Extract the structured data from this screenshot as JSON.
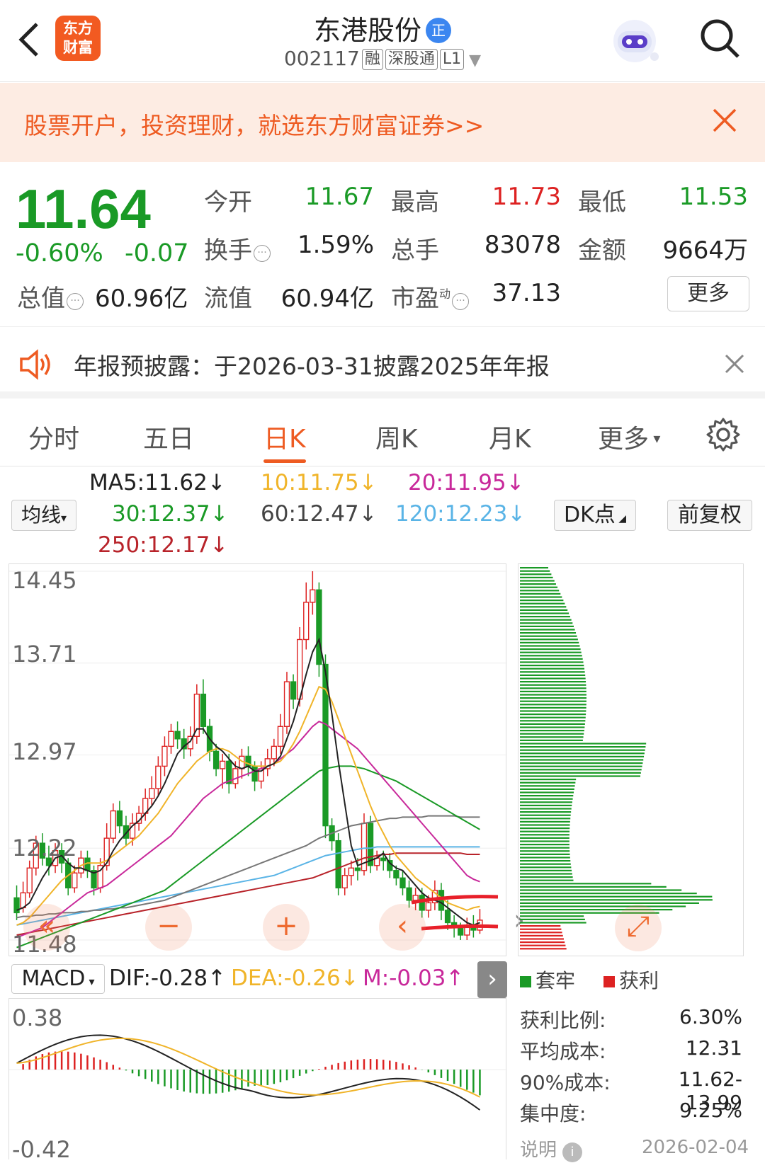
{
  "header": {
    "title": "东港股份",
    "title_badge": "正",
    "code": "002117",
    "tags": [
      "融",
      "深股通",
      "L1"
    ]
  },
  "banner": {
    "text": "股票开户，投资理财，就选东方财富证券>>"
  },
  "logo": {
    "line1": "东方",
    "line2": "财富"
  },
  "quote": {
    "price": "11.64",
    "change_pct": "-0.60%",
    "change": "-0.07",
    "open_label": "今开",
    "open": "11.67",
    "high_label": "最高",
    "high": "11.73",
    "low_label": "最低",
    "low": "11.53",
    "turnover_label": "换手",
    "turnover": "1.59%",
    "volume_label": "总手",
    "volume": "83078",
    "amount_label": "金额",
    "amount": "9664万",
    "mktcap_label": "总值",
    "mktcap": "60.96亿",
    "float_label": "流值",
    "float": "60.94亿",
    "pe_label": "市盈",
    "pe_sup": "动",
    "pe": "37.13",
    "more": "更多"
  },
  "notice": {
    "text": "年报预披露：于2026-03-31披露2025年年报"
  },
  "tabs": [
    "分时",
    "五日",
    "日K",
    "周K",
    "月K",
    "更多"
  ],
  "ma": {
    "toggle": "均线",
    "ma5": "MA5:11.62↓",
    "ma10": "10:11.75↓",
    "ma20": "20:11.95↓",
    "ma30": "30:12.37↓",
    "ma60": "60:12.47↓",
    "ma120": "120:12.23↓",
    "ma250": "250:12.17↓",
    "dk": "DK点",
    "adj": "前复权"
  },
  "colors": {
    "up": "#dd2222",
    "down": "#1a9a26",
    "accent": "#ee5b22",
    "ma5": "#222222",
    "ma10": "#f0b429",
    "ma20": "#c8289a",
    "ma30": "#1a9a26",
    "ma60": "#777777",
    "ma120": "#5ab4e6",
    "ma250": "#b8232a"
  },
  "chart_data": {
    "type": "candlestick",
    "y_ticks": [
      "14.45",
      "13.71",
      "12.97",
      "12.22",
      "11.48"
    ],
    "ylim": [
      11.48,
      14.45
    ],
    "candles": [
      [
        11.82,
        11.7,
        11.92,
        11.64
      ],
      [
        11.74,
        11.86,
        11.95,
        11.7
      ],
      [
        11.86,
        12.06,
        12.12,
        11.82
      ],
      [
        12.06,
        12.26,
        12.32,
        12.0
      ],
      [
        12.26,
        12.14,
        12.34,
        12.08
      ],
      [
        12.14,
        12.08,
        12.24,
        12.0
      ],
      [
        12.08,
        12.2,
        12.26,
        12.02
      ],
      [
        12.2,
        12.1,
        12.26,
        12.02
      ],
      [
        12.1,
        11.9,
        12.14,
        11.84
      ],
      [
        11.9,
        12.02,
        12.08,
        11.86
      ],
      [
        12.02,
        12.14,
        12.2,
        11.98
      ],
      [
        12.14,
        12.04,
        12.2,
        11.98
      ],
      [
        12.04,
        11.9,
        12.08,
        11.84
      ],
      [
        11.9,
        12.08,
        12.14,
        11.86
      ],
      [
        12.08,
        12.3,
        12.42,
        12.04
      ],
      [
        12.3,
        12.52,
        12.58,
        12.26
      ],
      [
        12.52,
        12.4,
        12.6,
        12.34
      ],
      [
        12.4,
        12.3,
        12.48,
        12.24
      ],
      [
        12.3,
        12.42,
        12.5,
        12.24
      ],
      [
        12.42,
        12.5,
        12.56,
        12.36
      ],
      [
        12.5,
        12.62,
        12.7,
        12.44
      ],
      [
        12.62,
        12.7,
        12.8,
        12.56
      ],
      [
        12.7,
        12.88,
        12.96,
        12.64
      ],
      [
        12.88,
        13.04,
        13.12,
        12.8
      ],
      [
        13.04,
        13.16,
        13.22,
        12.98
      ],
      [
        13.16,
        13.1,
        13.24,
        13.02
      ],
      [
        13.1,
        13.02,
        13.18,
        12.94
      ],
      [
        13.02,
        13.12,
        13.2,
        12.96
      ],
      [
        13.12,
        13.46,
        13.54,
        13.06
      ],
      [
        13.46,
        13.2,
        13.58,
        13.14
      ],
      [
        13.2,
        13.0,
        13.26,
        12.92
      ],
      [
        13.0,
        12.86,
        13.06,
        12.8
      ],
      [
        12.86,
        12.92,
        12.98,
        12.7
      ],
      [
        12.92,
        12.74,
        12.98,
        12.66
      ],
      [
        12.74,
        12.86,
        12.92,
        12.7
      ],
      [
        12.86,
        12.96,
        13.02,
        12.78
      ],
      [
        12.96,
        12.88,
        13.04,
        12.8
      ],
      [
        12.88,
        12.76,
        12.92,
        12.68
      ],
      [
        12.76,
        12.86,
        12.92,
        12.7
      ],
      [
        12.86,
        12.94,
        13.02,
        12.8
      ],
      [
        12.94,
        13.04,
        13.1,
        12.88
      ],
      [
        13.04,
        13.2,
        13.3,
        12.98
      ],
      [
        13.2,
        13.56,
        13.64,
        13.14
      ],
      [
        13.56,
        13.42,
        13.62,
        13.34
      ],
      [
        13.42,
        13.9,
        14.0,
        13.36
      ],
      [
        13.9,
        14.2,
        14.36,
        13.82
      ],
      [
        14.2,
        14.3,
        14.45,
        14.1
      ],
      [
        14.3,
        13.7,
        14.36,
        13.6
      ],
      [
        13.7,
        12.4,
        13.78,
        12.3
      ],
      [
        12.4,
        12.28,
        12.46,
        12.2
      ],
      [
        12.28,
        11.9,
        12.34,
        11.84
      ],
      [
        11.9,
        12.0,
        12.06,
        11.84
      ],
      [
        12.0,
        12.06,
        12.12,
        11.92
      ],
      [
        12.06,
        12.04,
        12.14,
        11.96
      ],
      [
        12.04,
        12.42,
        12.5,
        12.0
      ],
      [
        12.42,
        12.08,
        12.48,
        12.02
      ],
      [
        12.08,
        12.14,
        12.2,
        12.04
      ],
      [
        12.14,
        12.12,
        12.2,
        12.04
      ],
      [
        12.12,
        12.04,
        12.18,
        11.98
      ],
      [
        12.04,
        11.98,
        12.08,
        11.92
      ],
      [
        11.98,
        11.9,
        12.04,
        11.84
      ],
      [
        11.9,
        11.8,
        11.96,
        11.74
      ],
      [
        11.8,
        11.84,
        11.9,
        11.72
      ],
      [
        11.84,
        11.72,
        11.9,
        11.66
      ],
      [
        11.72,
        11.78,
        11.84,
        11.66
      ],
      [
        11.78,
        11.88,
        11.96,
        11.72
      ],
      [
        11.88,
        11.72,
        11.94,
        11.64
      ],
      [
        11.72,
        11.62,
        11.8,
        11.56
      ],
      [
        11.62,
        11.58,
        11.68,
        11.5
      ],
      [
        11.58,
        11.52,
        11.62,
        11.48
      ],
      [
        11.52,
        11.6,
        11.66,
        11.48
      ],
      [
        11.6,
        11.56,
        11.68,
        11.5
      ],
      [
        11.56,
        11.64,
        11.73,
        11.53
      ]
    ],
    "ma5_line": [
      11.72,
      11.74,
      11.78,
      11.88,
      11.98,
      12.06,
      12.14,
      12.16,
      12.1,
      12.06,
      12.06,
      12.04,
      12.02,
      12.04,
      12.1,
      12.2,
      12.28,
      12.34,
      12.4,
      12.44,
      12.5,
      12.56,
      12.64,
      12.74,
      12.86,
      12.98,
      13.04,
      13.08,
      13.18,
      13.18,
      13.1,
      13.04,
      13.0,
      12.94,
      12.88,
      12.86,
      12.88,
      12.84,
      12.84,
      12.88,
      12.9,
      12.96,
      13.1,
      13.24,
      13.42,
      13.62,
      13.8,
      13.9,
      13.64,
      13.3,
      12.92,
      12.58,
      12.24,
      12.08,
      12.1,
      12.12,
      12.14,
      12.18,
      12.1,
      12.06,
      12.04,
      11.98,
      11.92,
      11.86,
      11.82,
      11.8,
      11.78,
      11.74,
      11.7,
      11.66,
      11.62,
      11.6,
      11.62
    ],
    "ma10_line": [
      11.6,
      11.62,
      11.66,
      11.72,
      11.78,
      11.84,
      11.9,
      11.96,
      12.0,
      12.04,
      12.08,
      12.1,
      12.1,
      12.1,
      12.12,
      12.16,
      12.2,
      12.24,
      12.28,
      12.32,
      12.38,
      12.44,
      12.5,
      12.58,
      12.66,
      12.74,
      12.8,
      12.86,
      12.92,
      12.96,
      13.0,
      13.02,
      13.02,
      13.0,
      12.96,
      12.92,
      12.9,
      12.88,
      12.88,
      12.88,
      12.9,
      12.92,
      12.98,
      13.06,
      13.16,
      13.28,
      13.4,
      13.52,
      13.5,
      13.4,
      13.26,
      13.12,
      12.98,
      12.84,
      12.7,
      12.56,
      12.44,
      12.34,
      12.24,
      12.16,
      12.1,
      12.04,
      11.98,
      11.94,
      11.9,
      11.86,
      11.82,
      11.78,
      11.76,
      11.74,
      11.72,
      11.74,
      11.75
    ],
    "ma20_line": [
      11.5,
      11.52,
      11.54,
      11.56,
      11.58,
      11.62,
      11.66,
      11.7,
      11.74,
      11.78,
      11.82,
      11.86,
      11.88,
      11.9,
      11.92,
      11.96,
      12.0,
      12.04,
      12.08,
      12.12,
      12.16,
      12.2,
      12.24,
      12.28,
      12.32,
      12.38,
      12.44,
      12.5,
      12.56,
      12.62,
      12.66,
      12.7,
      12.74,
      12.76,
      12.78,
      12.8,
      12.82,
      12.84,
      12.86,
      12.88,
      12.9,
      12.94,
      12.98,
      13.02,
      13.08,
      13.14,
      13.2,
      13.24,
      13.22,
      13.18,
      13.14,
      13.1,
      13.06,
      13.02,
      12.96,
      12.9,
      12.84,
      12.78,
      12.72,
      12.66,
      12.6,
      12.54,
      12.48,
      12.42,
      12.36,
      12.3,
      12.24,
      12.18,
      12.12,
      12.06,
      12.0,
      11.97,
      11.95
    ],
    "ma30_line": [
      11.42,
      11.44,
      11.46,
      11.48,
      11.5,
      11.52,
      11.54,
      11.56,
      11.58,
      11.6,
      11.62,
      11.64,
      11.66,
      11.68,
      11.7,
      11.72,
      11.74,
      11.76,
      11.78,
      11.8,
      11.82,
      11.84,
      11.86,
      11.88,
      11.92,
      11.96,
      12.0,
      12.04,
      12.08,
      12.12,
      12.16,
      12.2,
      12.24,
      12.28,
      12.32,
      12.36,
      12.4,
      12.44,
      12.48,
      12.52,
      12.56,
      12.6,
      12.64,
      12.68,
      12.72,
      12.76,
      12.8,
      12.84,
      12.86,
      12.87,
      12.88,
      12.88,
      12.88,
      12.87,
      12.86,
      12.84,
      12.82,
      12.8,
      12.78,
      12.76,
      12.73,
      12.7,
      12.67,
      12.64,
      12.61,
      12.58,
      12.55,
      12.52,
      12.49,
      12.46,
      12.43,
      12.4,
      12.37
    ],
    "ma60_line": [
      11.66,
      11.67,
      11.67,
      11.68,
      11.68,
      11.69,
      11.69,
      11.7,
      11.7,
      11.7,
      11.71,
      11.71,
      11.72,
      11.72,
      11.73,
      11.73,
      11.74,
      11.74,
      11.75,
      11.76,
      11.77,
      11.78,
      11.79,
      11.8,
      11.82,
      11.84,
      11.86,
      11.88,
      11.9,
      11.92,
      11.94,
      11.96,
      11.98,
      12.0,
      12.02,
      12.04,
      12.06,
      12.08,
      12.1,
      12.12,
      12.14,
      12.16,
      12.18,
      12.2,
      12.22,
      12.24,
      12.27,
      12.3,
      12.32,
      12.34,
      12.36,
      12.38,
      12.4,
      12.41,
      12.42,
      12.43,
      12.44,
      12.45,
      12.46,
      12.46,
      12.47,
      12.47,
      12.47,
      12.47,
      12.48,
      12.48,
      12.48,
      12.48,
      12.48,
      12.47,
      12.47,
      12.47,
      12.47
    ],
    "ma120_line": [
      11.6,
      11.61,
      11.62,
      11.63,
      11.64,
      11.65,
      11.66,
      11.67,
      11.68,
      11.69,
      11.7,
      11.71,
      11.72,
      11.73,
      11.74,
      11.75,
      11.76,
      11.77,
      11.78,
      11.79,
      11.8,
      11.81,
      11.82,
      11.83,
      11.84,
      11.85,
      11.86,
      11.87,
      11.88,
      11.89,
      11.9,
      11.91,
      11.92,
      11.93,
      11.94,
      11.95,
      11.96,
      11.97,
      11.98,
      11.99,
      12.0,
      12.02,
      12.04,
      12.06,
      12.08,
      12.1,
      12.12,
      12.14,
      12.16,
      12.17,
      12.18,
      12.19,
      12.2,
      12.21,
      12.22,
      12.22,
      12.23,
      12.23,
      12.23,
      12.23,
      12.23,
      12.23,
      12.23,
      12.23,
      12.23,
      12.23,
      12.23,
      12.23,
      12.23,
      12.23,
      12.23,
      12.23,
      12.23
    ],
    "ma250_line": [
      11.52,
      11.53,
      11.54,
      11.55,
      11.56,
      11.57,
      11.58,
      11.59,
      11.6,
      11.61,
      11.62,
      11.63,
      11.64,
      11.65,
      11.66,
      11.67,
      11.68,
      11.69,
      11.7,
      11.71,
      11.72,
      11.73,
      11.74,
      11.75,
      11.76,
      11.77,
      11.78,
      11.79,
      11.8,
      11.81,
      11.82,
      11.83,
      11.84,
      11.85,
      11.86,
      11.87,
      11.88,
      11.89,
      11.9,
      11.91,
      11.92,
      11.93,
      11.94,
      11.95,
      11.96,
      11.97,
      11.98,
      12.0,
      12.02,
      12.04,
      12.06,
      12.08,
      12.1,
      12.12,
      12.14,
      12.15,
      12.16,
      12.17,
      12.17,
      12.18,
      12.18,
      12.18,
      12.18,
      12.18,
      12.18,
      12.18,
      12.18,
      12.18,
      12.18,
      12.18,
      12.17,
      12.17,
      12.17
    ],
    "distribution": {
      "legend_loss": "套牢",
      "legend_profit": "获利",
      "profit_ratio_label": "获利比例:",
      "profit_ratio": "6.30%",
      "avg_cost_label": "平均成本:",
      "avg_cost": "12.31",
      "cost90_label": "90%成本:",
      "cost90": "11.62-13.99",
      "concentration_label": "集中度:",
      "concentration": "9.25%",
      "note_label": "说明",
      "date": "2026-02-04"
    },
    "macd": {
      "label": "MACD",
      "dif": "DIF:-0.28↑",
      "dea": "DEA:-0.26↓",
      "m": "M:-0.03↑",
      "y_ticks": [
        "0.38",
        "-0.42"
      ]
    }
  }
}
